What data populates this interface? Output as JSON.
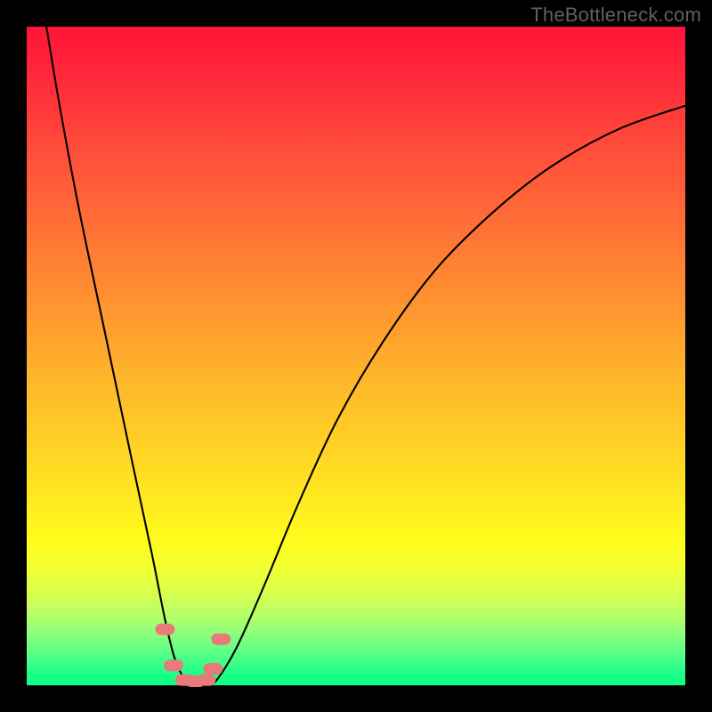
{
  "watermark": "TheBottleneck.com",
  "chart_data": {
    "type": "line",
    "title": "",
    "xlabel": "",
    "ylabel": "",
    "xlim": [
      0,
      100
    ],
    "ylim": [
      0,
      100
    ],
    "series": [
      {
        "name": "bottleneck-curve",
        "x": [
          3,
          5,
          8,
          12,
          16,
          19,
          21,
          22.5,
          24,
          26,
          27.5,
          29,
          32,
          36,
          41,
          47,
          54,
          62,
          71,
          80,
          90,
          100
        ],
        "values": [
          100,
          88,
          72,
          53,
          34,
          20,
          10,
          4,
          1,
          0,
          0,
          1,
          6,
          15,
          27,
          40,
          52,
          63,
          72,
          79,
          84.5,
          88
        ]
      }
    ],
    "markers": [
      {
        "name": "marker-left-upper",
        "x": 21.0,
        "y": 8.5
      },
      {
        "name": "marker-left-lower",
        "x": 22.3,
        "y": 3.0
      },
      {
        "name": "marker-right-upper",
        "x": 29.5,
        "y": 7.0
      },
      {
        "name": "marker-right-lower",
        "x": 28.3,
        "y": 2.5
      },
      {
        "name": "marker-bottom-a",
        "x": 24.0,
        "y": 0.8
      },
      {
        "name": "marker-bottom-b",
        "x": 25.6,
        "y": 0.6
      },
      {
        "name": "marker-bottom-c",
        "x": 27.2,
        "y": 0.8
      }
    ],
    "marker_color": "#e97a7a",
    "curve_color": "#000000"
  }
}
